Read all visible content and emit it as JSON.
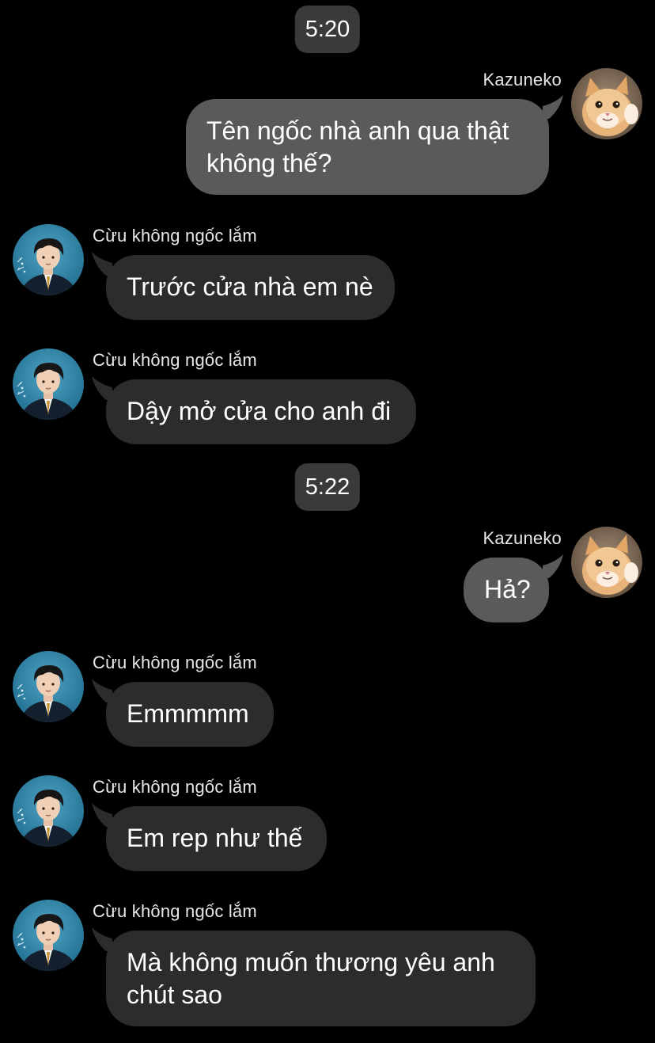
{
  "colors": {
    "background": "#000000",
    "my_bubble": "#5a5a5c",
    "their_bubble": "#2c2c2e",
    "time_pill": "#3a3a3c",
    "text": "#ffffff"
  },
  "timestamps": [
    "5:20",
    "5:22"
  ],
  "messages": [
    {
      "sender": "Kazuneko",
      "side": "right",
      "avatar_icon": "cat-avatar-icon",
      "text": "Tên ngốc nhà anh qua thật không thế?"
    },
    {
      "sender": "Cừu không ngốc lắm",
      "side": "left",
      "avatar_icon": "boy-avatar-icon",
      "text": "Trước cửa nhà em nè"
    },
    {
      "sender": "Cừu không ngốc lắm",
      "side": "left",
      "avatar_icon": "boy-avatar-icon",
      "text": "Dậy mở cửa cho anh đi"
    },
    {
      "sender": "Kazuneko",
      "side": "right",
      "avatar_icon": "cat-avatar-icon",
      "text": "Hả?"
    },
    {
      "sender": "Cừu không ngốc lắm",
      "side": "left",
      "avatar_icon": "boy-avatar-icon",
      "text": "Emmmmm"
    },
    {
      "sender": "Cừu không ngốc lắm",
      "side": "left",
      "avatar_icon": "boy-avatar-icon",
      "text": "Em rep như thế"
    },
    {
      "sender": "Cừu không ngốc lắm",
      "side": "left",
      "avatar_icon": "boy-avatar-icon",
      "text": "Mà không muốn thương yêu anh chút sao"
    }
  ]
}
